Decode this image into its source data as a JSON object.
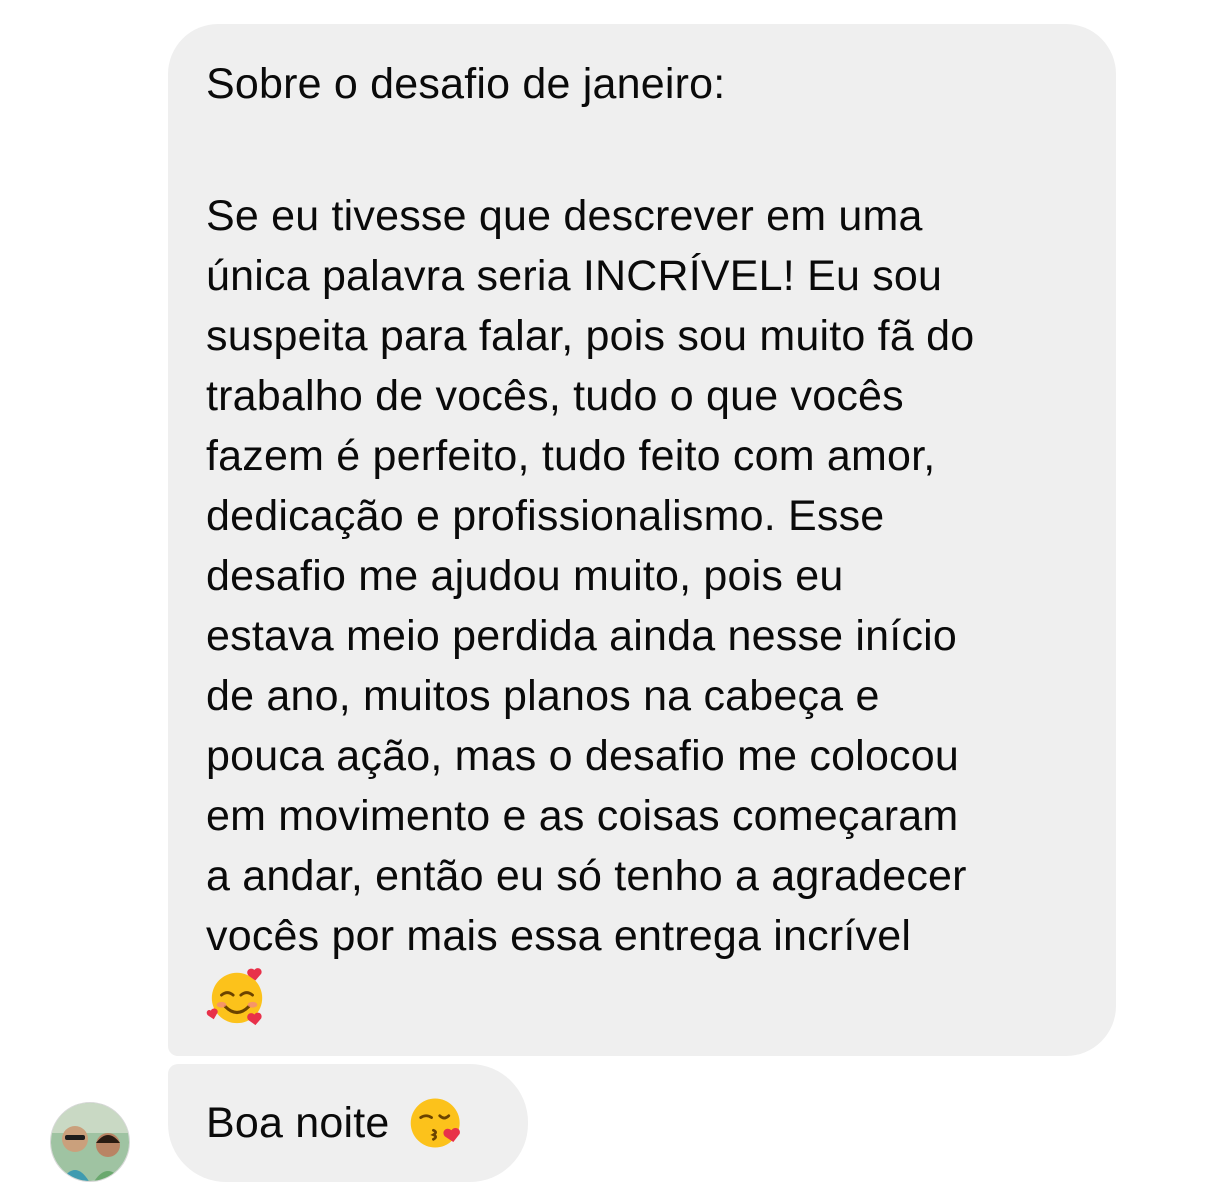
{
  "messages": [
    {
      "heading": "Sobre o desafio de janeiro:",
      "lines": [
        "Se eu tivesse que descrever em uma",
        "única palavra seria INCRÍVEL! Eu sou",
        "suspeita para falar, pois sou muito fã do",
        "trabalho de vocês, tudo o que vocês",
        "fazem é perfeito, tudo feito com amor,",
        "dedicação e profissionalismo. Esse",
        "desafio me ajudou muito, pois eu",
        "estava meio perdida ainda nesse início",
        "de ano, muitos planos na cabeça e",
        "pouca ação, mas o desafio me colocou",
        "em movimento e as coisas começaram",
        "a andar, então eu só tenho a agradecer",
        "vocês por mais essa entrega incrível"
      ],
      "trailing_emoji": "smiling-face-with-hearts"
    },
    {
      "text": "Boa noite",
      "trailing_emoji": "face-blowing-kiss"
    }
  ],
  "colors": {
    "bubble": "#efefef",
    "text": "#0a0a0a",
    "emoji_yellow": "#fcc21b",
    "heart_red": "#e8314a"
  },
  "sender_avatar": "sender-avatar-photo"
}
